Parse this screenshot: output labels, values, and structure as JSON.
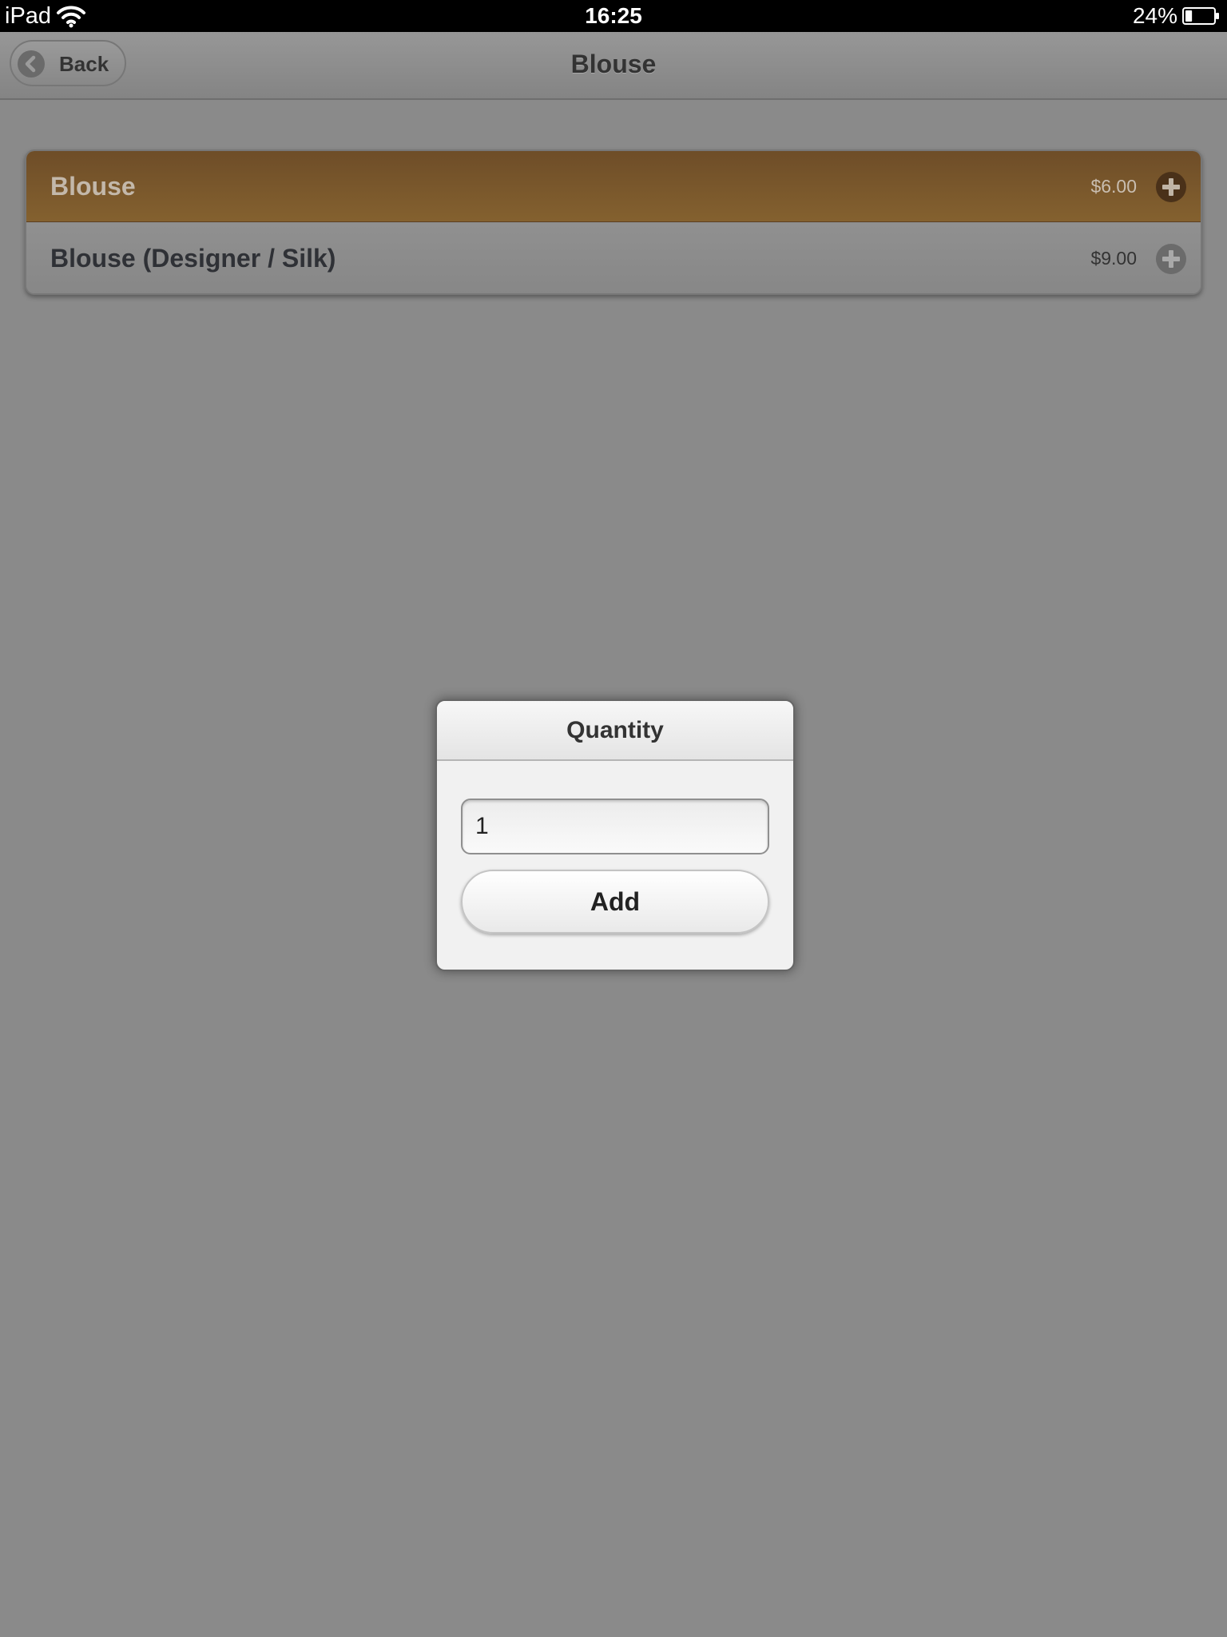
{
  "status_bar": {
    "device": "iPad",
    "time": "16:25",
    "battery_percent": "24%",
    "battery_level": 0.24,
    "wifi_icon": "wifi-icon",
    "battery_icon": "battery-icon"
  },
  "header": {
    "title": "Blouse",
    "back_label": "Back",
    "back_icon": "chevron-left-icon"
  },
  "products": {
    "items": [
      {
        "name": "Blouse",
        "price": "$6.00",
        "selected": true,
        "icon": "plus-circle-icon"
      },
      {
        "name": "Blouse (Designer / Silk)",
        "price": "$9.00",
        "selected": false,
        "icon": "plus-circle-icon"
      }
    ]
  },
  "dialog": {
    "title": "Quantity",
    "quantity_value": "1",
    "add_label": "Add"
  },
  "colors": {
    "selected_row": "#7a5a2e",
    "overlay_background": "#8a8a8a",
    "dialog_background": "#f1f1f1"
  }
}
